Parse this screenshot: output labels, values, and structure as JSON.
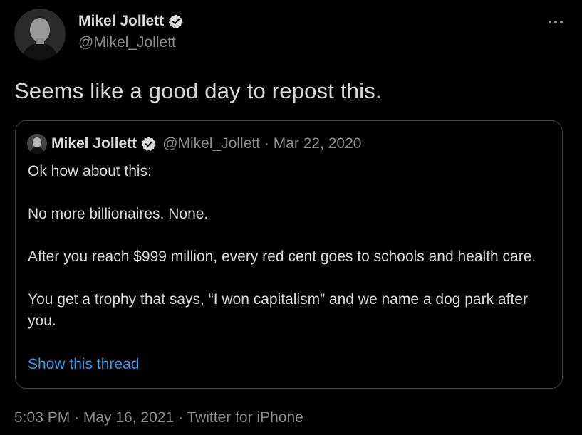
{
  "tweet": {
    "author": {
      "display_name": "Mikel Jollett",
      "handle": "@Mikel_Jollett",
      "verified": true,
      "avatar_icon": "profile-photo"
    },
    "text": "Seems like a good day to repost this.",
    "more_icon": "more-horizontal-icon",
    "timestamp": "5:03 PM · May 16, 2021 · Twitter for iPhone"
  },
  "quoted_tweet": {
    "author": {
      "display_name": "Mikel Jollett",
      "handle": "@Mikel_Jollett",
      "verified": true
    },
    "meta": "@Mikel_Jollett · Mar 22, 2020",
    "paragraphs": [
      "Ok how about this:",
      "No more billionaires. None.",
      "After you reach $999 million, every red cent goes to schools and health care.",
      "You get a trophy that says, “I won capitalism” and we name a dog park after you."
    ],
    "show_thread_label": "Show this thread"
  },
  "colors": {
    "background": "#000000",
    "text": "#d9d9d9",
    "secondary_text": "#8a8d91",
    "link": "#3a97e0",
    "border": "#3a3d40"
  }
}
